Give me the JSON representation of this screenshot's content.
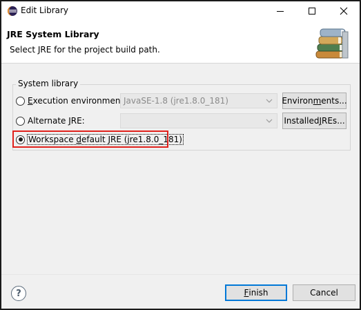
{
  "window": {
    "title": "Edit Library"
  },
  "header": {
    "title": "JRE System Library",
    "description": "Select JRE for the project build path."
  },
  "group": {
    "label": "System library",
    "execution_environment": {
      "label_pre": "",
      "mnemonic": "E",
      "label_post": "xecution environment:",
      "combo_value": "JavaSE-1.8 (jre1.8.0_181)",
      "button_pre": "Environ",
      "button_mnemonic": "m",
      "button_post": "ents...",
      "selected": false
    },
    "alternate_jre": {
      "label_pre": "Alternate ",
      "mnemonic": "J",
      "label_post": "RE:",
      "combo_value": "",
      "button_pre": "Installed ",
      "button_mnemonic": "J",
      "button_post": "REs...",
      "selected": false
    },
    "workspace_default": {
      "label_pre": "Workspace ",
      "mnemonic": "d",
      "label_post": "efault JRE (jre1.8.0_181)",
      "selected": true
    }
  },
  "footer": {
    "help_glyph": "?",
    "finish_pre": "",
    "finish_mnemonic": "F",
    "finish_post": "inish",
    "cancel_label": "Cancel"
  },
  "colors": {
    "highlight": "#e0201b",
    "primary_border": "#0078d7"
  }
}
